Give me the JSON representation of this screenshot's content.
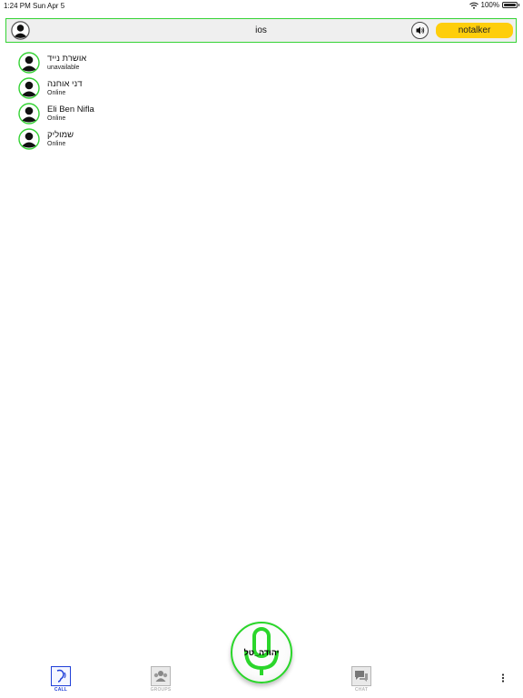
{
  "status_bar": {
    "time": "1:24 PM",
    "date": "Sun Apr 5",
    "battery": "100%"
  },
  "header": {
    "title": "ios",
    "notalker_label": "notalker"
  },
  "contacts": [
    {
      "name": "אושרת נייד",
      "status": "unavailable"
    },
    {
      "name": "דני אוחנה",
      "status": "Online"
    },
    {
      "name": "Eli Ben Nifla",
      "status": "Online"
    },
    {
      "name": "שמוליק",
      "status": "Online"
    }
  ],
  "mic": {
    "label": "יהודה_טל"
  },
  "nav": {
    "call": "CALL",
    "groups": "GROUPS",
    "chat": "CHAT"
  },
  "colors": {
    "accent_green": "#35d335",
    "notalker_yellow": "#fece0b",
    "call_blue": "#1f3fd8"
  }
}
